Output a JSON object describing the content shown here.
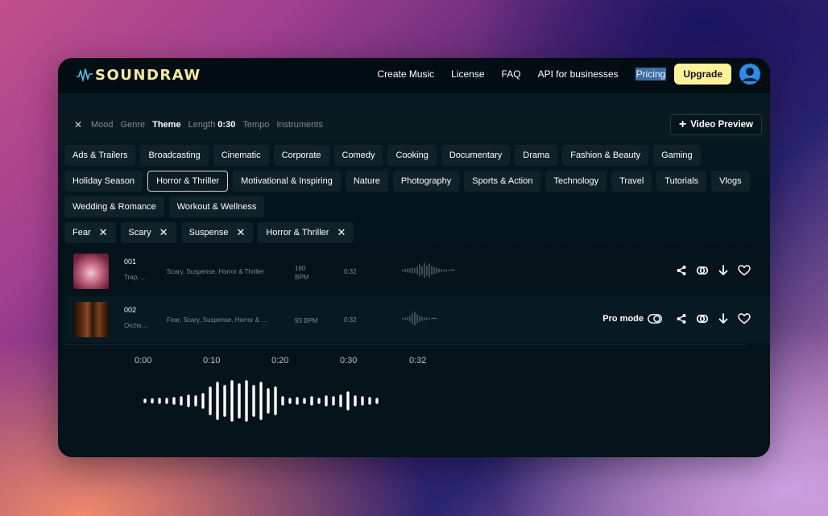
{
  "brand": {
    "name": "SOUNDRAW"
  },
  "nav": {
    "links": [
      "Create Music",
      "License",
      "FAQ",
      "API for businesses"
    ],
    "pricing": "Pricing",
    "upgrade": "Upgrade"
  },
  "filters": {
    "close": "✕",
    "tabs": [
      "Mood",
      "Genre",
      "Theme"
    ],
    "length_label": "Length",
    "length_value": "0:30",
    "tabs_after": [
      "Tempo",
      "Instruments"
    ],
    "active_tab": "Theme",
    "video_preview": "Video Preview"
  },
  "themes": {
    "row1": [
      "Ads & Trailers",
      "Broadcasting",
      "Cinematic",
      "Corporate",
      "Comedy",
      "Cooking",
      "Documentary",
      "Drama",
      "Fashion & Beauty",
      "Gaming"
    ],
    "row2": [
      "Holiday Season",
      "Horror & Thriller",
      "Motivational & Inspiring",
      "Nature",
      "Photography",
      "Sports & Action",
      "Technology",
      "Travel",
      "Tutorials",
      "Vlogs"
    ],
    "row3": [
      "Wedding & Romance",
      "Workout & Wellness"
    ],
    "selected": "Horror & Thriller"
  },
  "selected_tags": [
    "Fear",
    "Scary",
    "Suspense",
    "Horror & Thriller"
  ],
  "tracks": [
    {
      "number": "001",
      "genre": "Trap, …",
      "tags": "Scary, Suspense, Horror & Thriller",
      "bpm_value": "160",
      "bpm_unit": "BPM",
      "duration": "0:32"
    },
    {
      "number": "002",
      "genre": "Orche…",
      "tags": "Fear, Scary, Suspense, Horror & …",
      "bpm": "93 BPM",
      "duration": "0:32",
      "pro_mode": "Pro mode"
    }
  ],
  "player": {
    "timeline": [
      "0:00",
      "0:10",
      "0:20",
      "0:30",
      "0:32"
    ]
  },
  "colors": {
    "accent_yellow": "#fdf29a",
    "app_bg": "#04121a",
    "avatar_blue": "#2b8ee8"
  },
  "icons": [
    "logo-wave-icon",
    "close-icon",
    "plus-icon",
    "user-avatar-icon",
    "share-icon",
    "link-icon",
    "download-icon",
    "heart-icon",
    "toggle-icon",
    "waveform-icon"
  ]
}
